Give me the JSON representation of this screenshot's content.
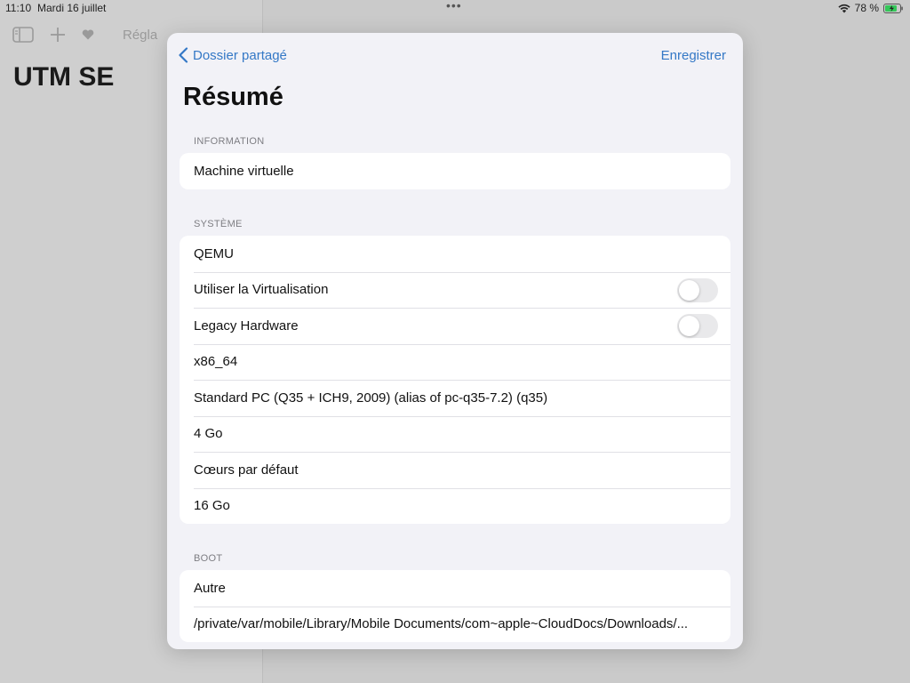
{
  "status_bar": {
    "time": "11:10",
    "date": "Mardi 16 juillet",
    "battery": "78 %"
  },
  "background": {
    "title": "UTM SE",
    "toolbar": {
      "sidebar_icon": "sidebar-icon",
      "add_icon": "plus-icon",
      "heart_icon": "heart-icon",
      "menu_label": "Régla"
    }
  },
  "sheet": {
    "back_label": "Dossier partagé",
    "save_label": "Enregistrer",
    "title": "Résumé",
    "sections": {
      "information": {
        "header": "INFORMATION",
        "rows": [
          "Machine virtuelle"
        ]
      },
      "systeme": {
        "header": "SYSTÈME",
        "rows": {
          "backend": "QEMU",
          "virtualisation": "Utiliser la Virtualisation",
          "legacy": "Legacy Hardware",
          "arch": "x86_64",
          "machine": "Standard PC (Q35 + ICH9, 2009) (alias of pc-q35-7.2) (q35)",
          "memory": "4 Go",
          "cores": "Cœurs par défaut",
          "storage": "16 Go"
        }
      },
      "boot": {
        "header": "BOOT",
        "rows": {
          "type": "Autre",
          "path": "/private/var/mobile/Library/Mobile Documents/com~apple~CloudDocs/Downloads/..."
        }
      }
    },
    "toggles": {
      "virtualisation": false,
      "legacy": false
    }
  },
  "colors": {
    "accent": "#3478c6",
    "sheet_bg": "#f2f2f7",
    "toggle_off": "#e9e9eb"
  }
}
